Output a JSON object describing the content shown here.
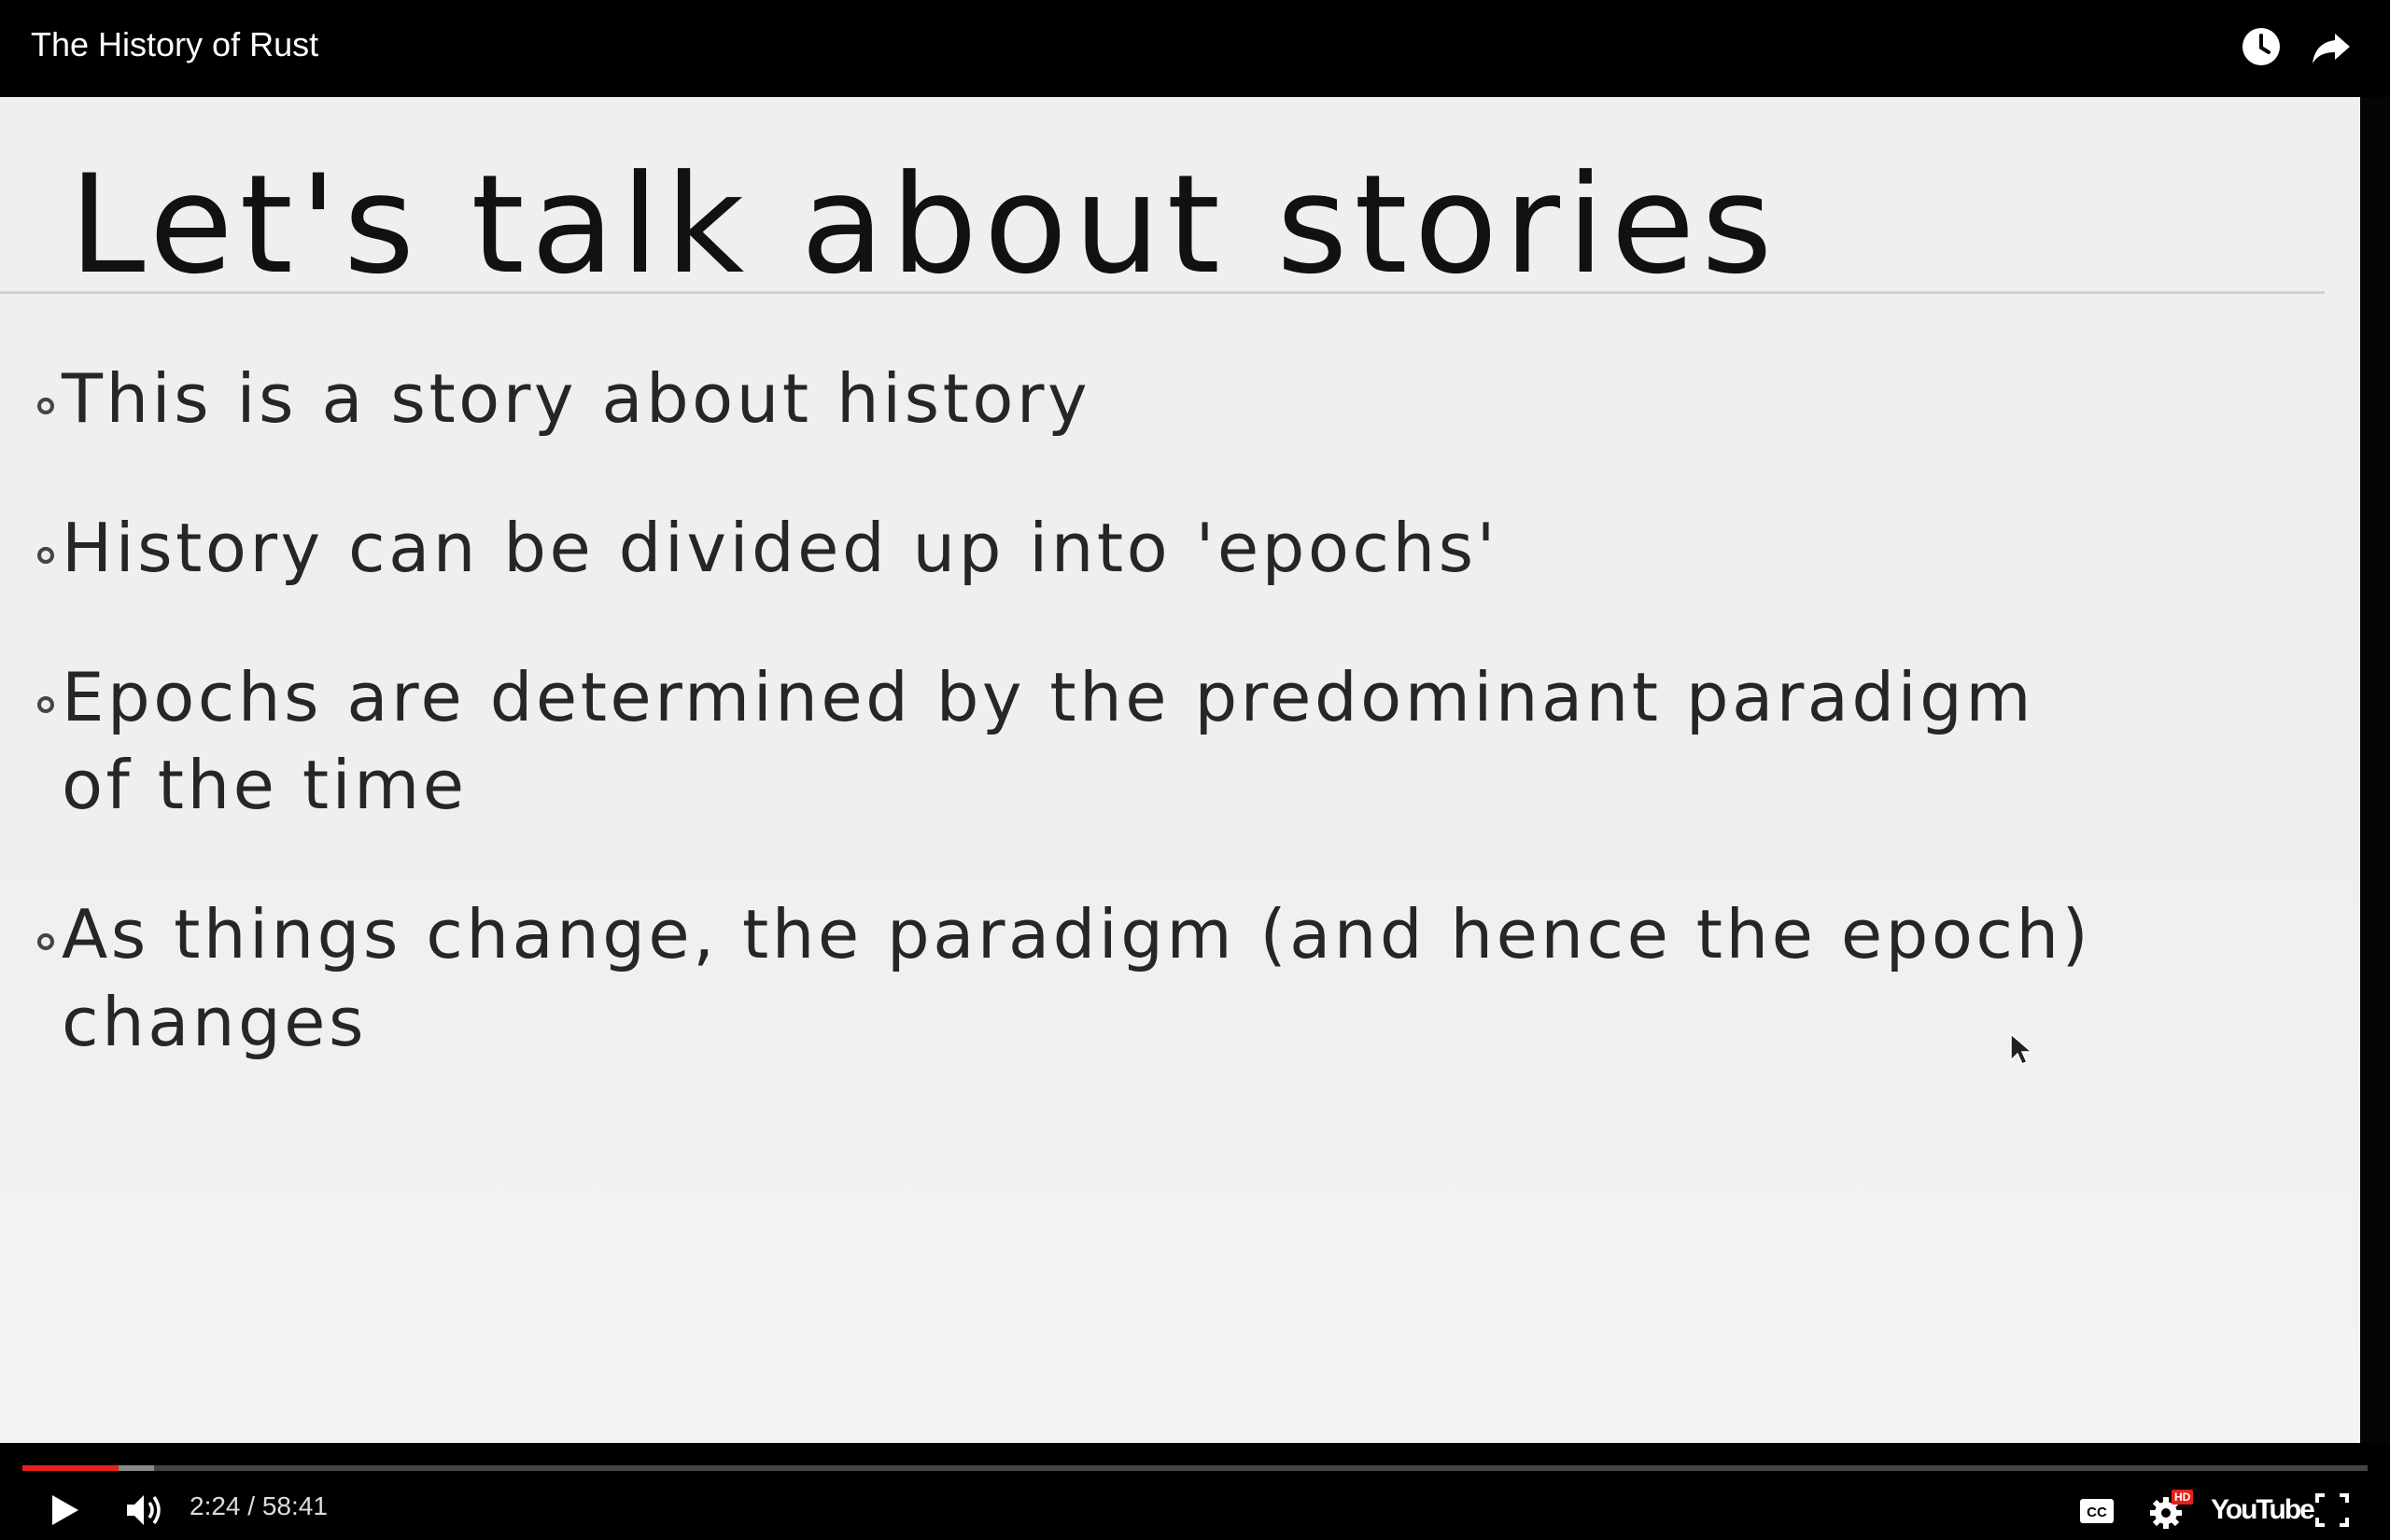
{
  "header": {
    "title": "The History of Rust",
    "watch_later_icon": "clock-icon",
    "share_icon": "share-arrow-icon"
  },
  "slide": {
    "title": "Let's talk about stories",
    "bullets": [
      {
        "line1": "This is a story about history",
        "line2": ""
      },
      {
        "line1": "History can be divided up into 'epochs'",
        "line2": ""
      },
      {
        "line1": "Epochs are determined by the predominant paradigm",
        "line2": "of the time"
      },
      {
        "line1": "As things change, the paradigm (and hence the epoch)",
        "line2": "changes"
      }
    ]
  },
  "controls": {
    "time": "2:24 / 58:41",
    "progress_played_fraction": 0.041,
    "progress_buffered_fraction": 0.056,
    "youtube_label": "YouTube",
    "hd_badge": "HD",
    "accent_color": "#e62117"
  }
}
